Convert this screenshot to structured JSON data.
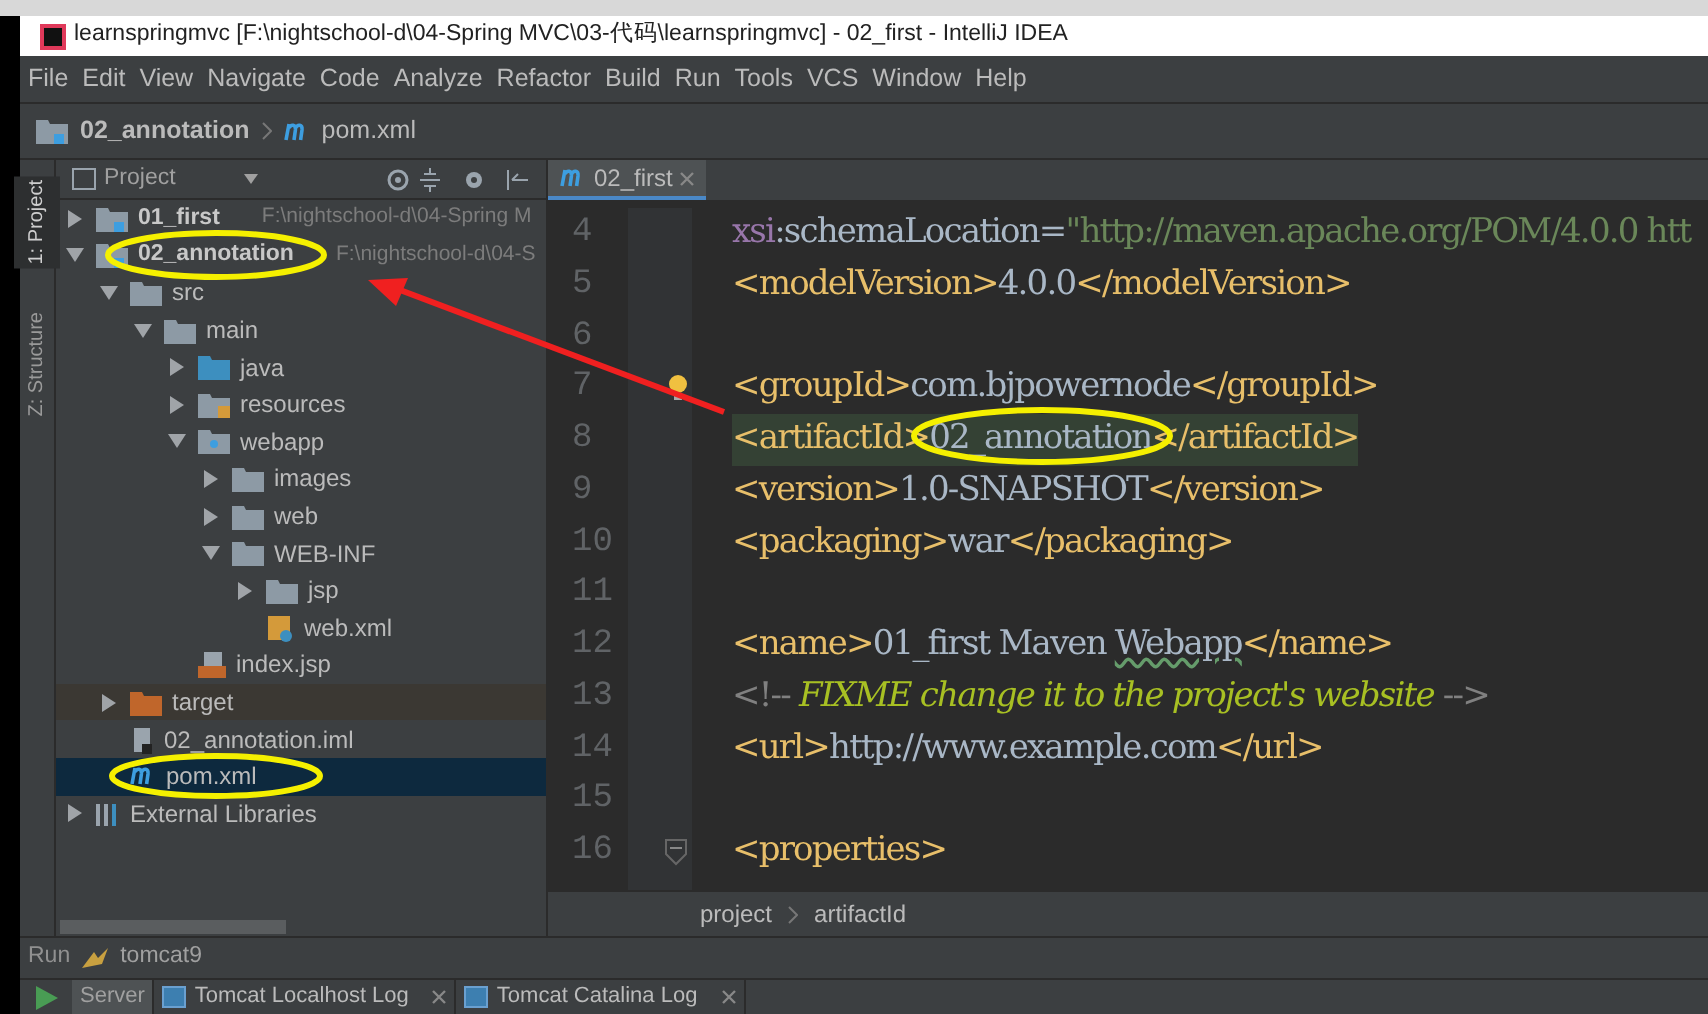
{
  "window": {
    "title": "learnspringmvc [F:\\nightschool-d\\04-Spring MVC\\03-代码\\learnspringmvc] - 02_first - IntelliJ IDEA"
  },
  "menu": [
    "File",
    "Edit",
    "View",
    "Navigate",
    "Code",
    "Analyze",
    "Refactor",
    "Build",
    "Run",
    "Tools",
    "VCS",
    "Window",
    "Help"
  ],
  "nav_bar": [
    {
      "label": "02_annotation",
      "kind": "module"
    },
    {
      "label": "pom.xml",
      "kind": "maven"
    }
  ],
  "tool_stripe": [
    {
      "label": "1: Project",
      "selected": true
    },
    {
      "label": "Z: Structure",
      "selected": false
    }
  ],
  "project_panel": {
    "title": "Project",
    "tree": [
      {
        "label": "01_first",
        "path": "F:\\nightschool-d\\04-Spring M",
        "kind": "module",
        "expanded": false,
        "selected": false
      },
      {
        "label": "02_annotation",
        "path": "F:\\nightschool-d\\04-S",
        "kind": "module",
        "expanded": true,
        "selected": false,
        "children": [
          {
            "label": "src",
            "kind": "folder",
            "expanded": true,
            "selected": false,
            "children": [
              {
                "label": "main",
                "kind": "folder",
                "expanded": true,
                "selected": false,
                "children": [
                  {
                    "label": "java",
                    "kind": "source",
                    "expanded": false,
                    "selected": false
                  },
                  {
                    "label": "resources",
                    "kind": "resources",
                    "expanded": false,
                    "selected": false
                  },
                  {
                    "label": "webapp",
                    "kind": "web",
                    "expanded": true,
                    "selected": false,
                    "children": [
                      {
                        "label": "images",
                        "kind": "folder",
                        "expanded": false,
                        "selected": false
                      },
                      {
                        "label": "web",
                        "kind": "folder",
                        "expanded": false,
                        "selected": false
                      },
                      {
                        "label": "WEB-INF",
                        "kind": "folder",
                        "expanded": true,
                        "selected": false,
                        "children": [
                          {
                            "label": "jsp",
                            "kind": "folder",
                            "expanded": false,
                            "selected": false
                          },
                          {
                            "label": "web.xml",
                            "kind": "xml",
                            "selected": false
                          }
                        ]
                      }
                    ]
                  },
                  {
                    "label": "index.jsp",
                    "kind": "jsp",
                    "selected": false
                  }
                ]
              }
            ]
          },
          {
            "label": "target",
            "kind": "excluded",
            "expanded": false,
            "selected": false
          },
          {
            "label": "02_annotation.iml",
            "kind": "iml",
            "selected": false
          },
          {
            "label": "pom.xml",
            "kind": "maven",
            "selected": true
          }
        ]
      },
      {
        "label": "External Libraries",
        "kind": "libraries",
        "expanded": false,
        "selected": false
      }
    ]
  },
  "editor": {
    "tabs": [
      {
        "label": "02_first",
        "selected": true
      }
    ],
    "lines": [
      {
        "number": "4",
        "tokens": [
          {
            "kind": "attr",
            "text": "xsi"
          },
          {
            "kind": "text",
            "text": ":schemaLocation="
          },
          {
            "kind": "string",
            "text": "\"http://maven.apache.org/POM/4.0.0 htt"
          }
        ]
      },
      {
        "number": "5",
        "tokens": [
          {
            "kind": "tag",
            "text": "<modelVersion>"
          },
          {
            "kind": "text",
            "text": "4.0.0"
          },
          {
            "kind": "tag",
            "text": "</modelVersion>"
          }
        ]
      },
      {
        "number": "6"
      },
      {
        "number": "7",
        "tokens": [
          {
            "kind": "tag",
            "text": "<groupId>"
          },
          {
            "kind": "text",
            "text": "com.bjpowernode"
          },
          {
            "kind": "tag",
            "text": "</groupId>"
          }
        ],
        "bulb": true
      },
      {
        "number": "8",
        "tokens": [
          {
            "kind": "tag",
            "text": "<artifactId>"
          },
          {
            "kind": "text",
            "text": "02_annotation"
          },
          {
            "kind": "tag",
            "text": "</artifactId>"
          }
        ],
        "current": true
      },
      {
        "number": "9",
        "tokens": [
          {
            "kind": "tag",
            "text": "<version>"
          },
          {
            "kind": "text",
            "text": "1.0-SNAPSHOT"
          },
          {
            "kind": "tag",
            "text": "</version>"
          }
        ]
      },
      {
        "number": "10",
        "tokens": [
          {
            "kind": "tag",
            "text": "<packaging>"
          },
          {
            "kind": "text",
            "text": "war"
          },
          {
            "kind": "tag",
            "text": "</packaging>"
          }
        ]
      },
      {
        "number": "11"
      },
      {
        "number": "12",
        "tokens": [
          {
            "kind": "tag",
            "text": "<name>"
          },
          {
            "kind": "text",
            "text": "01_first Maven "
          },
          {
            "kind": "typo",
            "text": "Webapp"
          },
          {
            "kind": "tag",
            "text": "</name>"
          }
        ]
      },
      {
        "number": "13",
        "tokens": [
          {
            "kind": "comment",
            "text": "<!-- "
          },
          {
            "kind": "todo",
            "text": "FIXME change it to the project's website"
          },
          {
            "kind": "comment",
            "text": " -->"
          }
        ]
      },
      {
        "number": "14",
        "tokens": [
          {
            "kind": "tag",
            "text": "<url>"
          },
          {
            "kind": "text",
            "text": "http://www.example.com"
          },
          {
            "kind": "tag",
            "text": "</url>"
          }
        ]
      },
      {
        "number": "15"
      },
      {
        "number": "16",
        "tokens": [
          {
            "kind": "tag",
            "text": "<properties>"
          }
        ],
        "fold": true
      }
    ],
    "breadcrumbs": [
      "project",
      "artifactId"
    ]
  },
  "run_panel": {
    "title": "Run",
    "config": "tomcat9",
    "tabs": [
      {
        "label": "Server",
        "selected": true,
        "closable": false
      },
      {
        "label": "Tomcat Localhost Log",
        "selected": false,
        "closable": true
      },
      {
        "label": "Tomcat Catalina Log",
        "selected": false,
        "closable": true
      }
    ]
  }
}
